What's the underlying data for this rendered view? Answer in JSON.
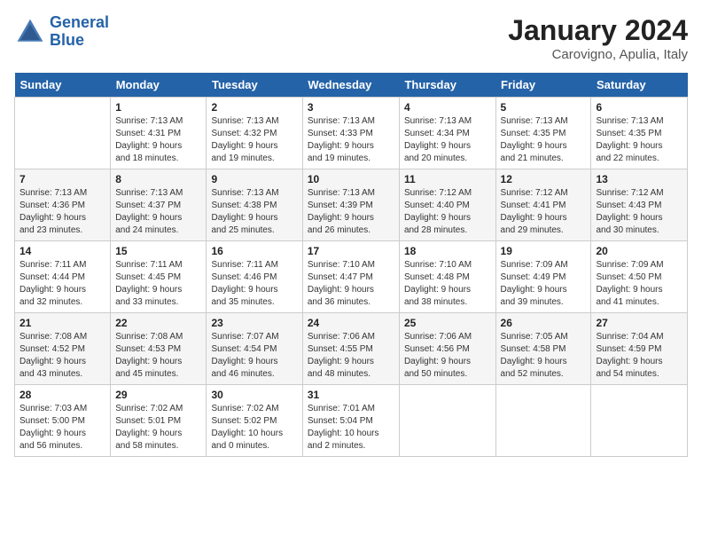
{
  "header": {
    "logo_line1": "General",
    "logo_line2": "Blue",
    "month_year": "January 2024",
    "location": "Carovigno, Apulia, Italy"
  },
  "weekdays": [
    "Sunday",
    "Monday",
    "Tuesday",
    "Wednesday",
    "Thursday",
    "Friday",
    "Saturday"
  ],
  "weeks": [
    [
      {
        "day": "",
        "info": ""
      },
      {
        "day": "1",
        "info": "Sunrise: 7:13 AM\nSunset: 4:31 PM\nDaylight: 9 hours\nand 18 minutes."
      },
      {
        "day": "2",
        "info": "Sunrise: 7:13 AM\nSunset: 4:32 PM\nDaylight: 9 hours\nand 19 minutes."
      },
      {
        "day": "3",
        "info": "Sunrise: 7:13 AM\nSunset: 4:33 PM\nDaylight: 9 hours\nand 19 minutes."
      },
      {
        "day": "4",
        "info": "Sunrise: 7:13 AM\nSunset: 4:34 PM\nDaylight: 9 hours\nand 20 minutes."
      },
      {
        "day": "5",
        "info": "Sunrise: 7:13 AM\nSunset: 4:35 PM\nDaylight: 9 hours\nand 21 minutes."
      },
      {
        "day": "6",
        "info": "Sunrise: 7:13 AM\nSunset: 4:35 PM\nDaylight: 9 hours\nand 22 minutes."
      }
    ],
    [
      {
        "day": "7",
        "info": "Sunrise: 7:13 AM\nSunset: 4:36 PM\nDaylight: 9 hours\nand 23 minutes."
      },
      {
        "day": "8",
        "info": "Sunrise: 7:13 AM\nSunset: 4:37 PM\nDaylight: 9 hours\nand 24 minutes."
      },
      {
        "day": "9",
        "info": "Sunrise: 7:13 AM\nSunset: 4:38 PM\nDaylight: 9 hours\nand 25 minutes."
      },
      {
        "day": "10",
        "info": "Sunrise: 7:13 AM\nSunset: 4:39 PM\nDaylight: 9 hours\nand 26 minutes."
      },
      {
        "day": "11",
        "info": "Sunrise: 7:12 AM\nSunset: 4:40 PM\nDaylight: 9 hours\nand 28 minutes."
      },
      {
        "day": "12",
        "info": "Sunrise: 7:12 AM\nSunset: 4:41 PM\nDaylight: 9 hours\nand 29 minutes."
      },
      {
        "day": "13",
        "info": "Sunrise: 7:12 AM\nSunset: 4:43 PM\nDaylight: 9 hours\nand 30 minutes."
      }
    ],
    [
      {
        "day": "14",
        "info": "Sunrise: 7:11 AM\nSunset: 4:44 PM\nDaylight: 9 hours\nand 32 minutes."
      },
      {
        "day": "15",
        "info": "Sunrise: 7:11 AM\nSunset: 4:45 PM\nDaylight: 9 hours\nand 33 minutes."
      },
      {
        "day": "16",
        "info": "Sunrise: 7:11 AM\nSunset: 4:46 PM\nDaylight: 9 hours\nand 35 minutes."
      },
      {
        "day": "17",
        "info": "Sunrise: 7:10 AM\nSunset: 4:47 PM\nDaylight: 9 hours\nand 36 minutes."
      },
      {
        "day": "18",
        "info": "Sunrise: 7:10 AM\nSunset: 4:48 PM\nDaylight: 9 hours\nand 38 minutes."
      },
      {
        "day": "19",
        "info": "Sunrise: 7:09 AM\nSunset: 4:49 PM\nDaylight: 9 hours\nand 39 minutes."
      },
      {
        "day": "20",
        "info": "Sunrise: 7:09 AM\nSunset: 4:50 PM\nDaylight: 9 hours\nand 41 minutes."
      }
    ],
    [
      {
        "day": "21",
        "info": "Sunrise: 7:08 AM\nSunset: 4:52 PM\nDaylight: 9 hours\nand 43 minutes."
      },
      {
        "day": "22",
        "info": "Sunrise: 7:08 AM\nSunset: 4:53 PM\nDaylight: 9 hours\nand 45 minutes."
      },
      {
        "day": "23",
        "info": "Sunrise: 7:07 AM\nSunset: 4:54 PM\nDaylight: 9 hours\nand 46 minutes."
      },
      {
        "day": "24",
        "info": "Sunrise: 7:06 AM\nSunset: 4:55 PM\nDaylight: 9 hours\nand 48 minutes."
      },
      {
        "day": "25",
        "info": "Sunrise: 7:06 AM\nSunset: 4:56 PM\nDaylight: 9 hours\nand 50 minutes."
      },
      {
        "day": "26",
        "info": "Sunrise: 7:05 AM\nSunset: 4:58 PM\nDaylight: 9 hours\nand 52 minutes."
      },
      {
        "day": "27",
        "info": "Sunrise: 7:04 AM\nSunset: 4:59 PM\nDaylight: 9 hours\nand 54 minutes."
      }
    ],
    [
      {
        "day": "28",
        "info": "Sunrise: 7:03 AM\nSunset: 5:00 PM\nDaylight: 9 hours\nand 56 minutes."
      },
      {
        "day": "29",
        "info": "Sunrise: 7:02 AM\nSunset: 5:01 PM\nDaylight: 9 hours\nand 58 minutes."
      },
      {
        "day": "30",
        "info": "Sunrise: 7:02 AM\nSunset: 5:02 PM\nDaylight: 10 hours\nand 0 minutes."
      },
      {
        "day": "31",
        "info": "Sunrise: 7:01 AM\nSunset: 5:04 PM\nDaylight: 10 hours\nand 2 minutes."
      },
      {
        "day": "",
        "info": ""
      },
      {
        "day": "",
        "info": ""
      },
      {
        "day": "",
        "info": ""
      }
    ]
  ]
}
